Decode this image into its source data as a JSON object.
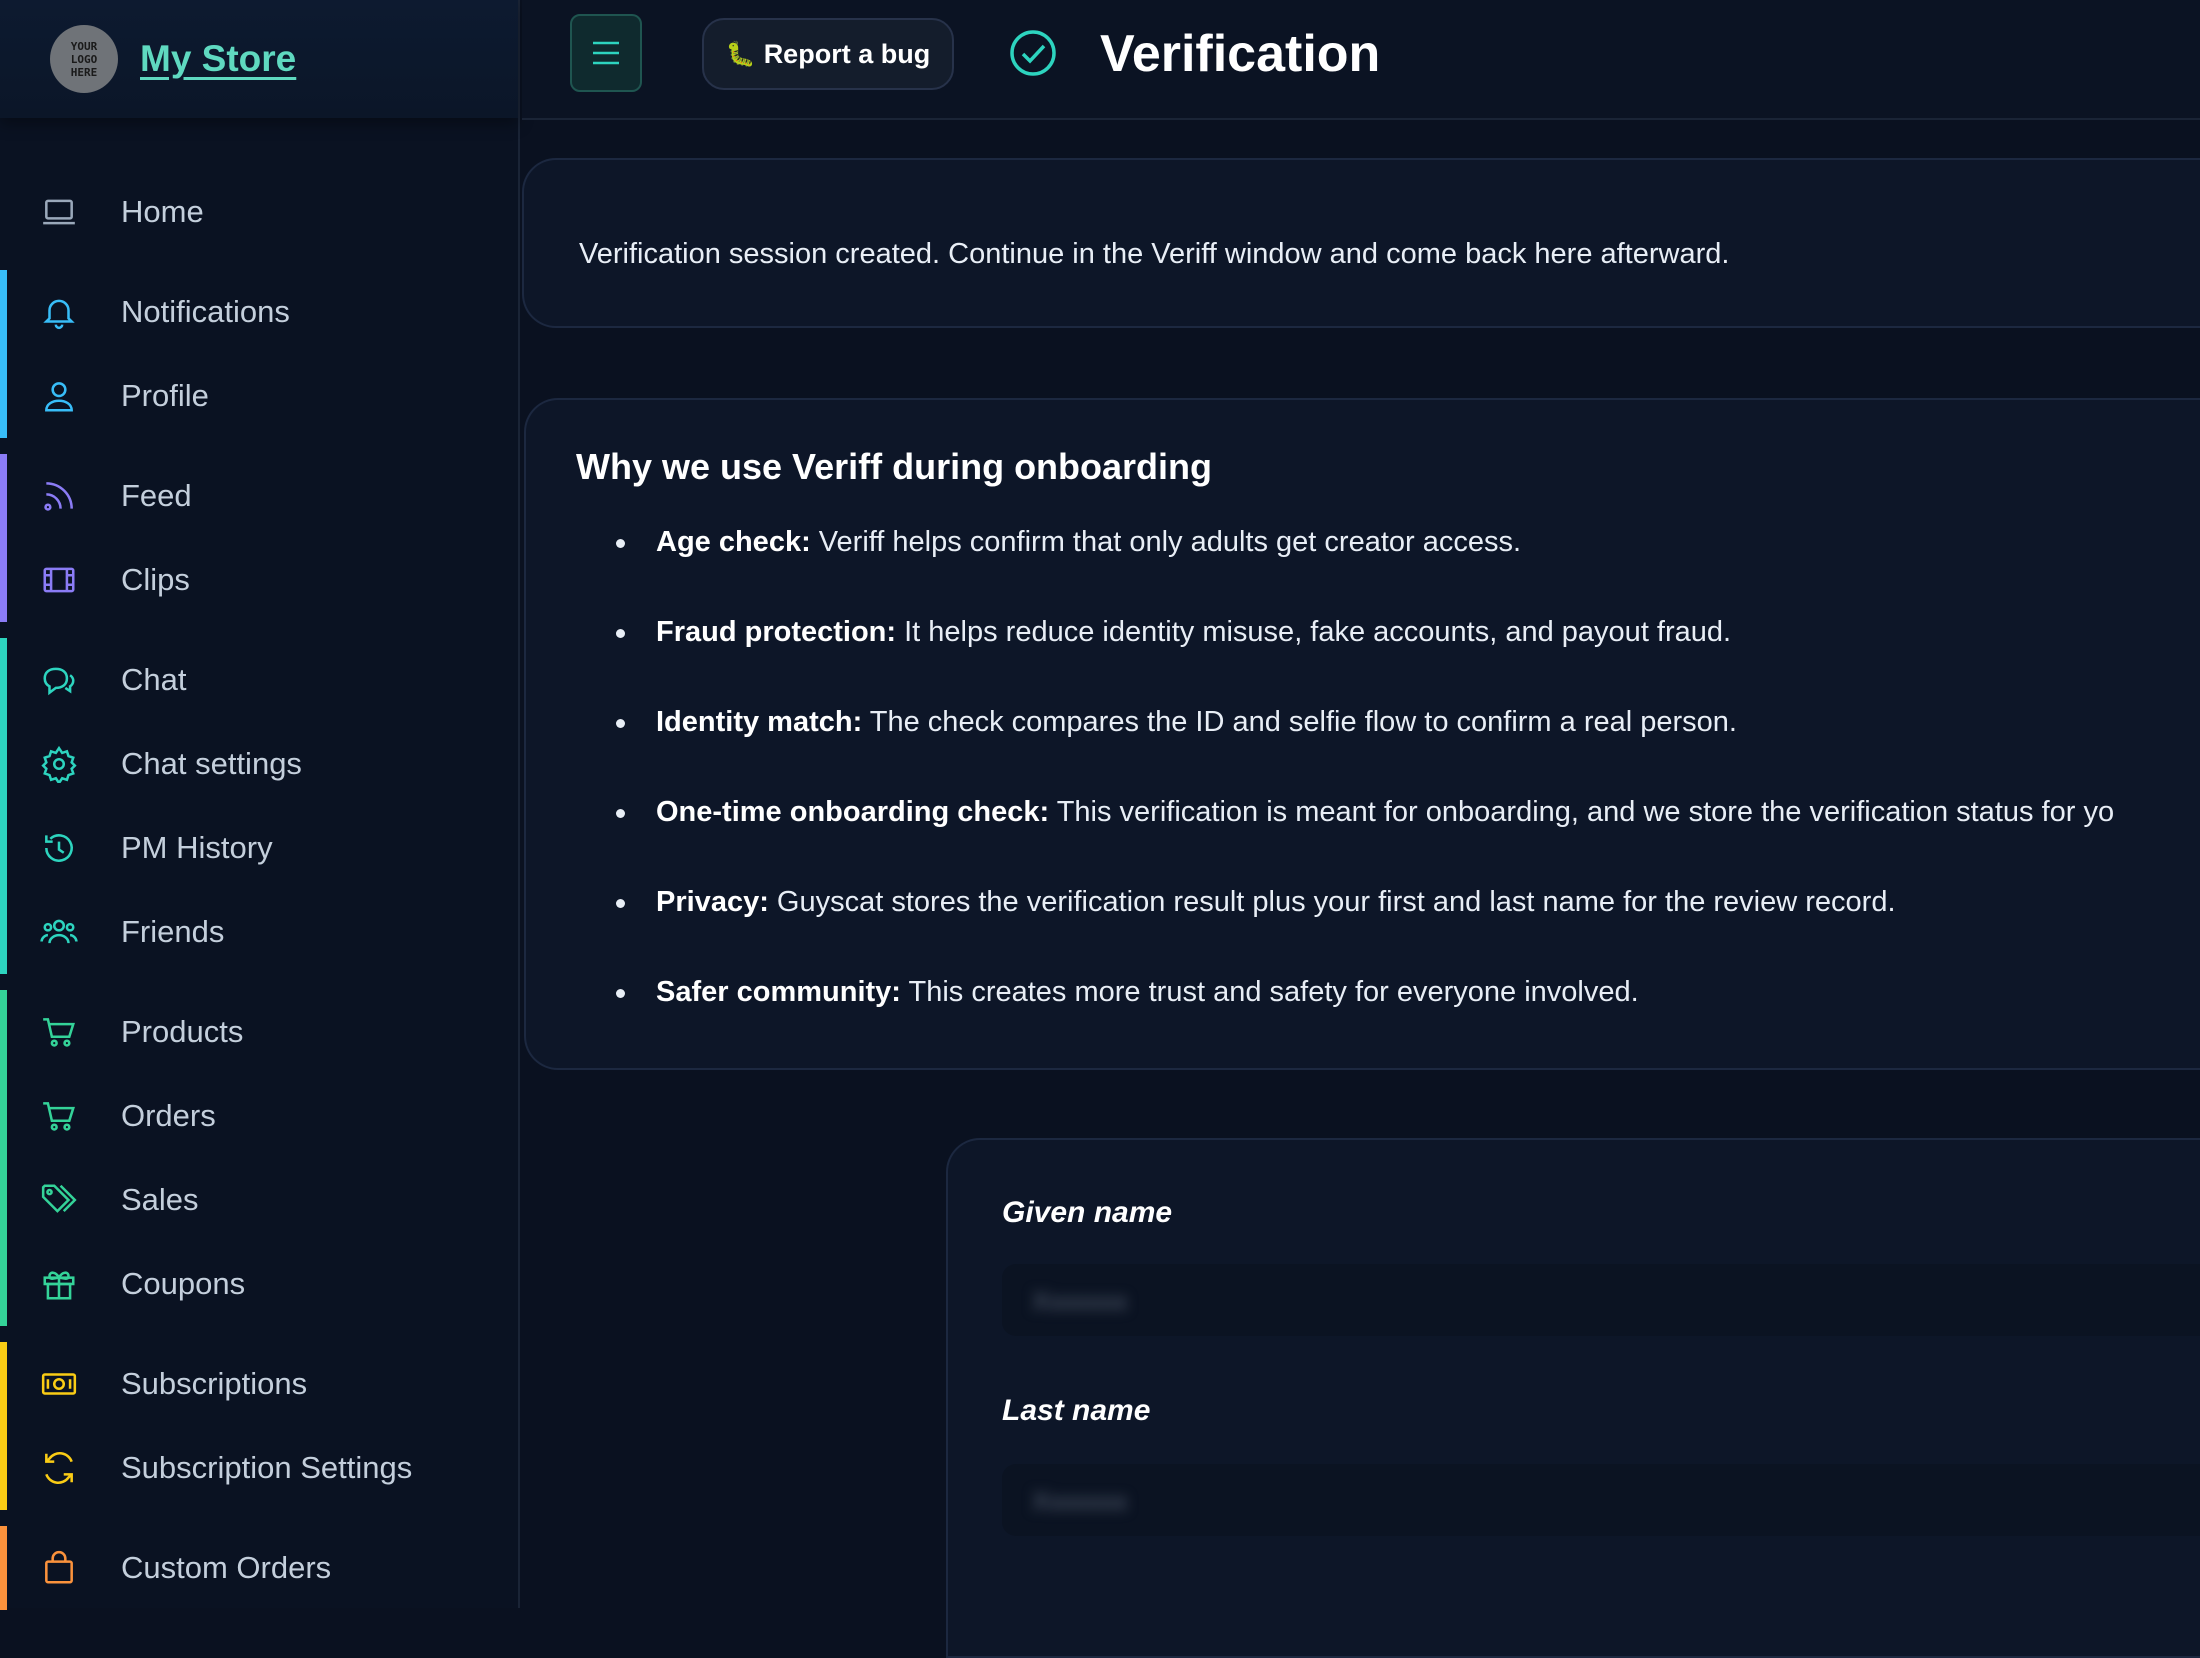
{
  "brand": {
    "logo_text": "YOUR LOGO HERE",
    "name": "My Store"
  },
  "topbar": {
    "bug_label": "Report a bug",
    "bug_emoji": "🐛",
    "title": "Verification"
  },
  "nav_groups": [
    {
      "color": "#0b1222",
      "items": [
        {
          "label": "Home",
          "icon": "laptop-icon"
        }
      ]
    },
    {
      "color": "#38bdf8",
      "items": [
        {
          "label": "Notifications",
          "icon": "bell-icon"
        },
        {
          "label": "Profile",
          "icon": "user-icon"
        }
      ]
    },
    {
      "color": "#8b7cf6",
      "items": [
        {
          "label": "Feed",
          "icon": "rss-icon"
        },
        {
          "label": "Clips",
          "icon": "film-icon"
        }
      ]
    },
    {
      "color": "#2dd4bf",
      "items": [
        {
          "label": "Chat",
          "icon": "chat-icon"
        },
        {
          "label": "Chat settings",
          "icon": "gear-icon"
        },
        {
          "label": "PM History",
          "icon": "history-icon"
        },
        {
          "label": "Friends",
          "icon": "users-icon"
        }
      ]
    },
    {
      "color": "#34d399",
      "items": [
        {
          "label": "Products",
          "icon": "cart-icon"
        },
        {
          "label": "Orders",
          "icon": "cart-icon"
        },
        {
          "label": "Sales",
          "icon": "tag-icon"
        },
        {
          "label": "Coupons",
          "icon": "gift-icon"
        }
      ]
    },
    {
      "color": "#facc15",
      "items": [
        {
          "label": "Subscriptions",
          "icon": "banknote-icon"
        },
        {
          "label": "Subscription Settings",
          "icon": "refresh-icon"
        }
      ]
    },
    {
      "color": "#fb923c",
      "items": [
        {
          "label": "Custom Orders",
          "icon": "bag-icon"
        }
      ]
    }
  ],
  "notice": {
    "text": "Verification session created. Continue in the Veriff window and come back here afterward."
  },
  "why": {
    "title": "Why we use Veriff during onboarding",
    "items": [
      {
        "bold": "Age check:",
        "text": " Veriff helps confirm that only adults get creator access."
      },
      {
        "bold": "Fraud protection:",
        "text": " It helps reduce identity misuse, fake accounts, and payout fraud."
      },
      {
        "bold": "Identity match:",
        "text": " The check compares the ID and selfie flow to confirm a real person."
      },
      {
        "bold": "One-time onboarding check:",
        "text": " This verification is meant for onboarding, and we store the verification status for yo"
      },
      {
        "bold": "Privacy:",
        "text": " Guyscat stores the verification result plus your first and last name for the review record."
      },
      {
        "bold": "Safer community:",
        "text": " This creates more trust and safety for everyone involved."
      }
    ]
  },
  "form": {
    "given_label": "Given name",
    "given_value": "Xxxxxxx",
    "last_label": "Last name",
    "last_value": "Xxxxxxx"
  }
}
